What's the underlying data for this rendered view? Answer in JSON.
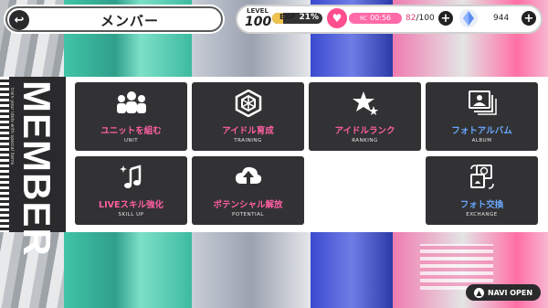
{
  "header": {
    "back_icon": "back-arrow-icon",
    "title": "メンバー"
  },
  "status": {
    "level_label": "LEVEL",
    "level_value": "100",
    "exp_label": "EXP",
    "exp_percent": "21%",
    "exp_fraction": 0.21,
    "stamina_prefix": "RC",
    "stamina_timer": "00:56",
    "stamina_current": "82",
    "stamina_max": "/100",
    "gems": "944"
  },
  "side": {
    "title": "MEMBER",
    "subtitle": "train your idols with special items"
  },
  "tiles": [
    {
      "jp": "ユニットを組む",
      "en": "UNIT",
      "icon": "people-group-icon"
    },
    {
      "jp": "アイドル育成",
      "en": "TRAINING",
      "icon": "hexagon-training-icon"
    },
    {
      "jp": "アイドルランク",
      "en": "RANKING",
      "icon": "star-rank-icon"
    },
    {
      "jp": "フォトアルバム",
      "en": "ALBUM",
      "icon": "photo-album-icon"
    },
    {
      "jp": "LIVEスキル強化",
      "en": "SKILL UP",
      "icon": "music-note-sparkle-icon"
    },
    {
      "jp": "ポテンシャル解放",
      "en": "POTENTIAL",
      "icon": "cloud-upload-icon"
    },
    {
      "jp": "フォト交換",
      "en": "EXCHANGE",
      "icon": "photo-exchange-icon"
    }
  ],
  "navi": {
    "label": "NAVI OPEN"
  },
  "colors": {
    "pink": "#ff5fa2",
    "blue": "#6aa8ff",
    "tile_bg": "#323234"
  }
}
